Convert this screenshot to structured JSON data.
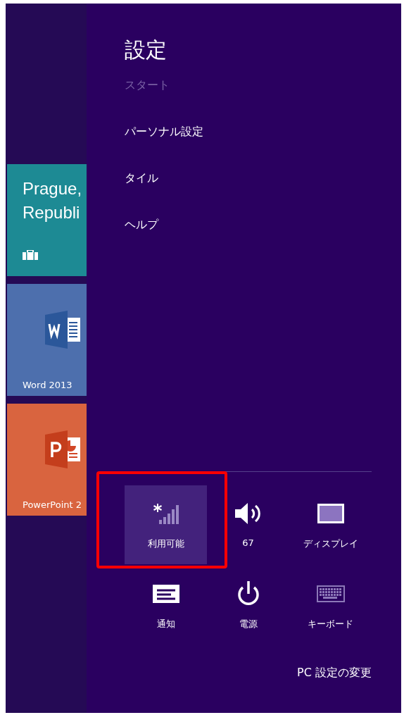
{
  "start_tiles": [
    {
      "kind": "travel",
      "lines": [
        "Prague,",
        "Republi"
      ],
      "color": "#1d8a94"
    },
    {
      "kind": "word",
      "label": "Word 2013",
      "color": "#4d6fad"
    },
    {
      "kind": "powerpoint",
      "label": "PowerPoint 2",
      "color": "#d9643f"
    }
  ],
  "settings_panel": {
    "title": "設定",
    "items": [
      {
        "label": "スタート",
        "disabled": true
      },
      {
        "label": "パーソナル設定",
        "disabled": false
      },
      {
        "label": "タイル",
        "disabled": false
      },
      {
        "label": "ヘルプ",
        "disabled": false
      }
    ],
    "quick_settings": [
      {
        "kind": "network",
        "label": "利用可能",
        "selected": true,
        "highlighted": true
      },
      {
        "kind": "volume",
        "label": "67",
        "selected": false,
        "highlighted": false
      },
      {
        "kind": "display",
        "label": "ディスプレイ",
        "selected": false,
        "highlighted": false
      },
      {
        "kind": "notifications",
        "label": "通知",
        "selected": false,
        "highlighted": false
      },
      {
        "kind": "power",
        "label": "電源",
        "selected": false,
        "highlighted": false
      },
      {
        "kind": "keyboard",
        "label": "キーボード",
        "selected": false,
        "highlighted": false
      }
    ],
    "change_pc_settings": "PC 設定の変更"
  }
}
